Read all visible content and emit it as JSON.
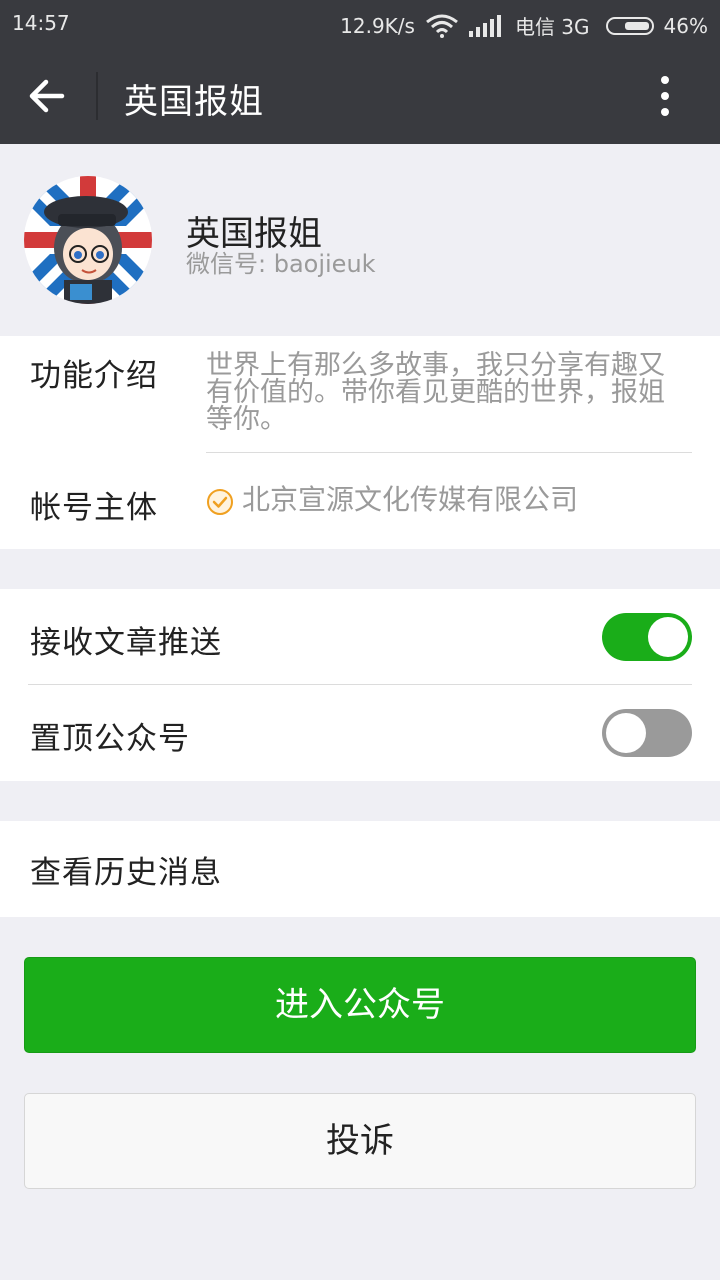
{
  "status_bar": {
    "time": "14:57",
    "network_speed": "12.9K/s",
    "carrier": "电信 3G",
    "battery": "46%"
  },
  "title_bar": {
    "title": "英国报姐",
    "back_icon": "arrow-left-icon",
    "more_icon": "more-vertical-icon"
  },
  "profile": {
    "name": "英国报姐",
    "wechat_id": "微信号: baojieuk"
  },
  "info": {
    "intro_label": "功能介绍",
    "intro_lines": [
      "世界上有那么多故事，我只分享有趣又",
      "有价值的。带你看见更酷的世界，报姐",
      "等你。"
    ],
    "owner_label": "帐号主体",
    "owner_value": "北京宣源文化传媒有限公司"
  },
  "settings": {
    "receive_push_label": "接收文章推送",
    "receive_push_on": true,
    "pin_top_label": "置顶公众号",
    "pin_top_on": false
  },
  "history": {
    "label": "查看历史消息"
  },
  "buttons": {
    "enter_label": "进入公众号",
    "report_label": "投诉"
  },
  "colors": {
    "accent": "#1aad19",
    "header": "#393a3f",
    "background": "#efeff4",
    "verified": "#f0a020"
  }
}
